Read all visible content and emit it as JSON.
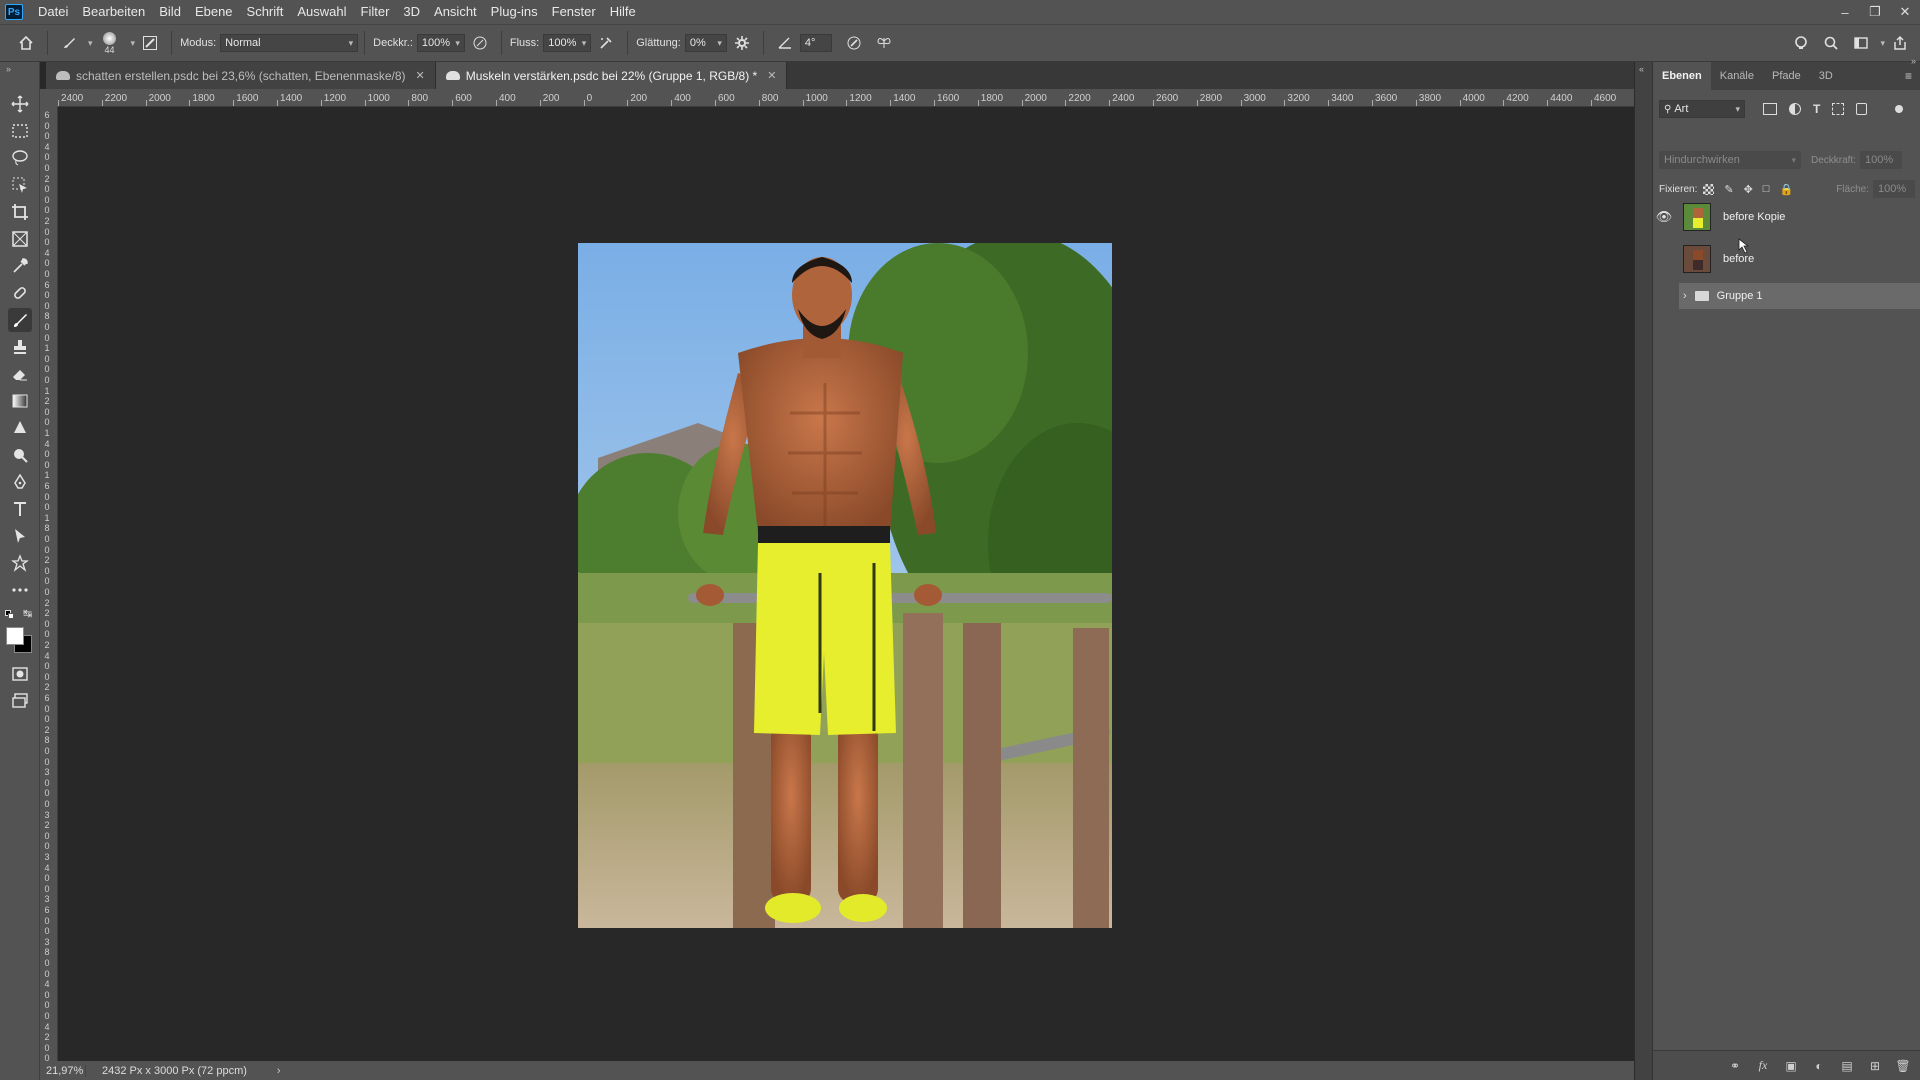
{
  "app": {
    "logo_text": "Ps"
  },
  "menu": [
    "Datei",
    "Bearbeiten",
    "Bild",
    "Ebene",
    "Schrift",
    "Auswahl",
    "Filter",
    "3D",
    "Ansicht",
    "Plug-ins",
    "Fenster",
    "Hilfe"
  ],
  "options": {
    "brush_size": "44",
    "mode_label": "Modus:",
    "mode_value": "Normal",
    "opacity_label": "Deckkr.:",
    "opacity_value": "100%",
    "flow_label": "Fluss:",
    "flow_value": "100%",
    "smoothing_label": "Glättung:",
    "smoothing_value": "0%",
    "angle_value": "4°"
  },
  "tabs": [
    {
      "label": "schatten erstellen.psdc bei 23,6% (schatten, Ebenenmaske/8)"
    },
    {
      "label": "Muskeln verstärken.psdc bei 22% (Gruppe 1, RGB/8) *"
    }
  ],
  "ruler_h": [
    "2400",
    "2200",
    "2000",
    "1800",
    "1600",
    "1400",
    "1200",
    "1000",
    "800",
    "600",
    "400",
    "200",
    "0",
    "200",
    "400",
    "600",
    "800",
    "1000",
    "1200",
    "1400",
    "1600",
    "1800",
    "2000",
    "2200",
    "2400",
    "2600",
    "2800",
    "3000",
    "3200",
    "3400",
    "3600",
    "3800",
    "4000",
    "4200",
    "4400",
    "4600"
  ],
  "status": {
    "zoom": "21,97%",
    "info": "2432 Px x 3000 Px (72 ppcm)"
  },
  "panel": {
    "tabs": [
      "Ebenen",
      "Kanäle",
      "Pfade",
      "3D"
    ],
    "filter_label": "Art",
    "blend_mode": "Hindurchwirken",
    "opacity_label": "Deckkraft:",
    "opacity_value": "100%",
    "lock_label": "Fixieren:",
    "fill_label": "Fläche:",
    "fill_value": "100%",
    "layers": [
      {
        "name": "before Kopie",
        "visible": true
      },
      {
        "name": "before",
        "visible": false
      },
      {
        "name": "Gruppe 1",
        "visible": false
      }
    ]
  },
  "colors": {
    "ui_bg": "#535353",
    "canvas_bg": "#282828",
    "accent": "#31a8ff",
    "shorts": "#e6ee2e"
  }
}
